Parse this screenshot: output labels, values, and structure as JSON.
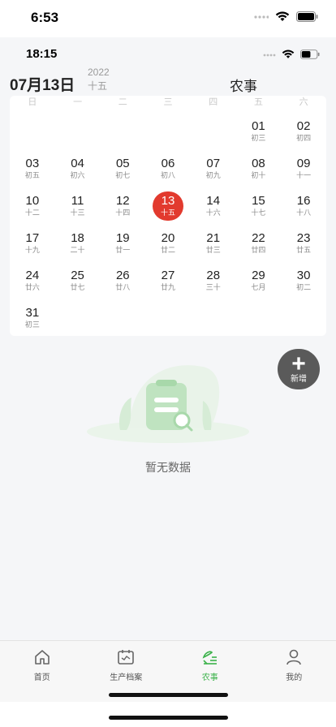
{
  "status_bar": {
    "time": "6:53"
  },
  "inner_status_bar": {
    "time": "18:15"
  },
  "header": {
    "date": "07月13日",
    "year": "2022",
    "lunar": "十五",
    "title": "农事"
  },
  "calendar": {
    "weekdays": [
      "日",
      "一",
      "二",
      "三",
      "四",
      "五",
      "六"
    ],
    "leading_blanks": 5,
    "selected_day": "13",
    "days": [
      {
        "num": "01",
        "lunar": "初三"
      },
      {
        "num": "02",
        "lunar": "初四"
      },
      {
        "num": "03",
        "lunar": "初五"
      },
      {
        "num": "04",
        "lunar": "初六"
      },
      {
        "num": "05",
        "lunar": "初七"
      },
      {
        "num": "06",
        "lunar": "初八"
      },
      {
        "num": "07",
        "lunar": "初九"
      },
      {
        "num": "08",
        "lunar": "初十"
      },
      {
        "num": "09",
        "lunar": "十一"
      },
      {
        "num": "10",
        "lunar": "十二"
      },
      {
        "num": "11",
        "lunar": "十三"
      },
      {
        "num": "12",
        "lunar": "十四"
      },
      {
        "num": "13",
        "lunar": "十五"
      },
      {
        "num": "14",
        "lunar": "十六"
      },
      {
        "num": "15",
        "lunar": "十七"
      },
      {
        "num": "16",
        "lunar": "十八"
      },
      {
        "num": "17",
        "lunar": "十九"
      },
      {
        "num": "18",
        "lunar": "二十"
      },
      {
        "num": "19",
        "lunar": "廿一"
      },
      {
        "num": "20",
        "lunar": "廿二"
      },
      {
        "num": "21",
        "lunar": "廿三"
      },
      {
        "num": "22",
        "lunar": "廿四"
      },
      {
        "num": "23",
        "lunar": "廿五"
      },
      {
        "num": "24",
        "lunar": "廿六"
      },
      {
        "num": "25",
        "lunar": "廿七"
      },
      {
        "num": "26",
        "lunar": "廿八"
      },
      {
        "num": "27",
        "lunar": "廿九"
      },
      {
        "num": "28",
        "lunar": "三十"
      },
      {
        "num": "29",
        "lunar": "七月"
      },
      {
        "num": "30",
        "lunar": "初二"
      },
      {
        "num": "31",
        "lunar": "初三"
      }
    ]
  },
  "add_button": {
    "label": "新增"
  },
  "empty_state": {
    "text": "暂无数据"
  },
  "tabbar": {
    "items": [
      {
        "label": "首页",
        "icon": "home-icon",
        "active": false
      },
      {
        "label": "生产档案",
        "icon": "calendar-archive-icon",
        "active": false
      },
      {
        "label": "农事",
        "icon": "farm-work-icon",
        "active": true
      },
      {
        "label": "我的",
        "icon": "person-icon",
        "active": false
      }
    ]
  },
  "colors": {
    "accent": "#3bb24a",
    "selected": "#e23a2e",
    "add_button": "#5a5a5a"
  }
}
